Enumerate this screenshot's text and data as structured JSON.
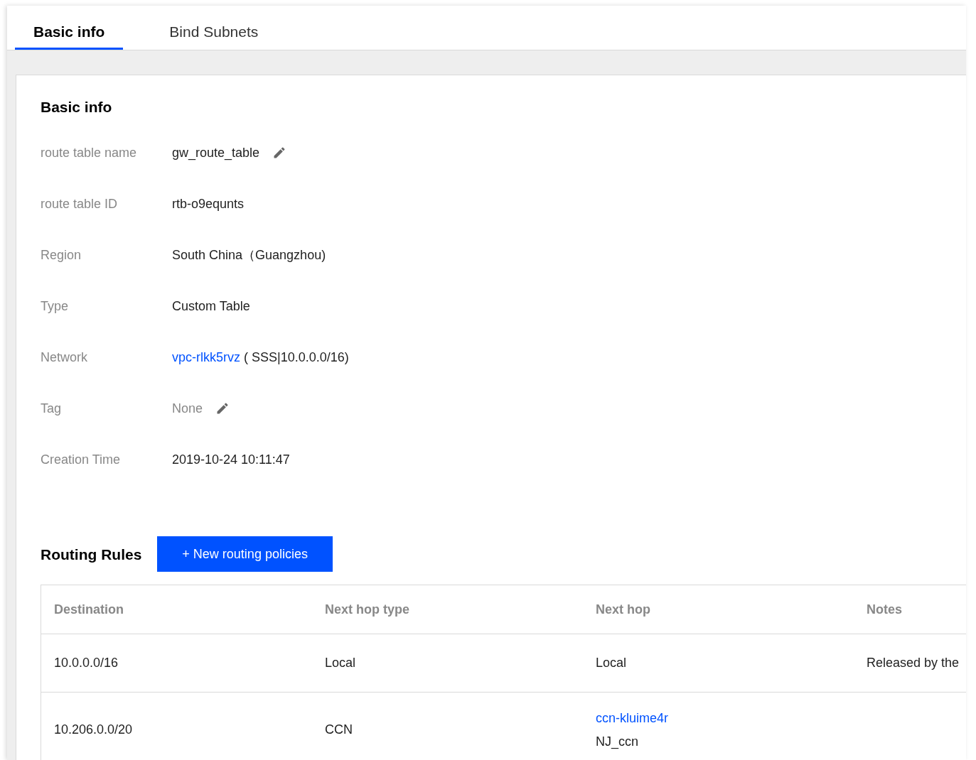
{
  "tabs": [
    {
      "label": "Basic info",
      "selected": true
    },
    {
      "label": "Bind Subnets",
      "selected": false
    }
  ],
  "basic_info": {
    "title": "Basic info",
    "fields": [
      {
        "label": "route table name",
        "kind": "text",
        "value": "gw_route_table",
        "editable": true,
        "empty": false
      },
      {
        "label": "route table ID",
        "kind": "text",
        "value": "rtb-o9equnts",
        "editable": false,
        "empty": false
      },
      {
        "label": "Region",
        "kind": "text",
        "value": "South China（Guangzhou)",
        "editable": false,
        "empty": false
      },
      {
        "label": "Type",
        "kind": "text",
        "value": "Custom Table",
        "editable": false,
        "empty": false
      },
      {
        "label": "Network",
        "kind": "link",
        "link": "vpc-rlkk5rvz",
        "value": "( SSS|10.0.0.0/16)",
        "editable": false,
        "empty": false
      },
      {
        "label": "Tag",
        "kind": "text",
        "value": "None",
        "editable": true,
        "empty": true
      },
      {
        "label": "Creation Time",
        "kind": "text",
        "value": "2019-10-24 10:11:47",
        "editable": false,
        "empty": false
      }
    ]
  },
  "routing_rules": {
    "title": "Routing Rules",
    "new_button": "+ New routing policies",
    "columns": [
      "Destination",
      "Next hop type",
      "Next hop",
      "Notes"
    ],
    "rows": [
      {
        "destination": "10.0.0.0/16",
        "next_hop_type": "Local",
        "next_hop": {
          "kind": "text",
          "text": "Local"
        },
        "notes": "Released by the"
      },
      {
        "destination": "10.206.0.0/20",
        "next_hop_type": "CCN",
        "next_hop": {
          "kind": "link",
          "text": "ccn-kluime4r",
          "subtext": "NJ_ccn"
        }
      }
    ]
  }
}
